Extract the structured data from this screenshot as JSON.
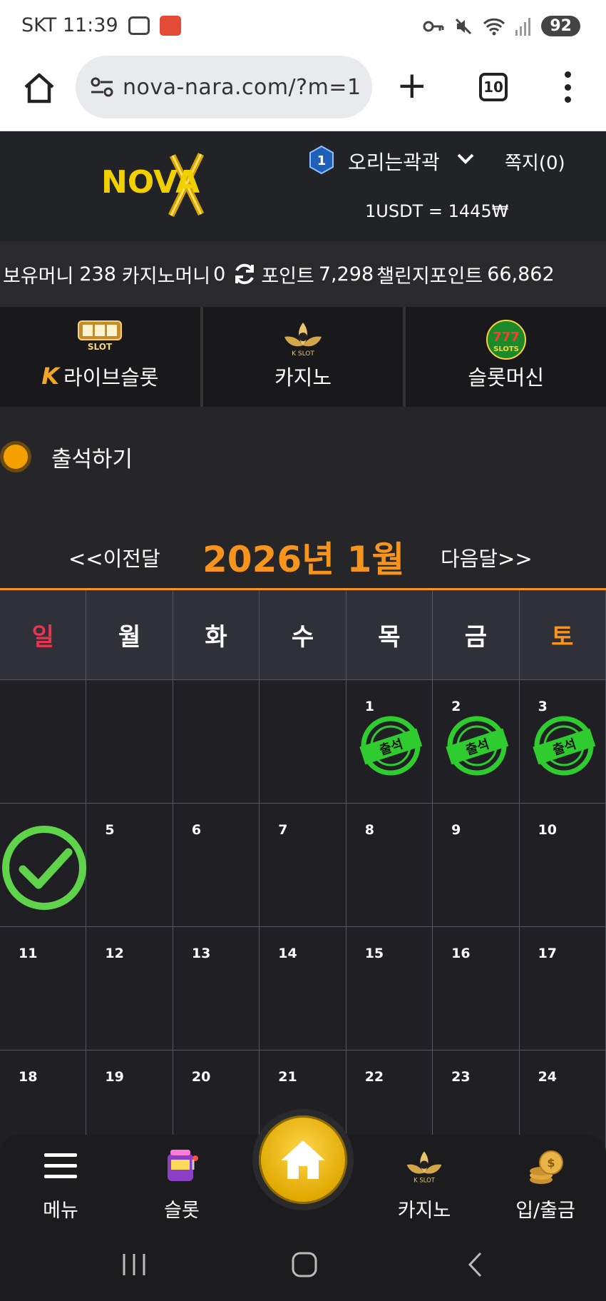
{
  "status_bar": {
    "carrier_time": "SKT 11:39",
    "battery": "92"
  },
  "browser": {
    "url": "nova-nara.com/?m=1",
    "tab_count": "10"
  },
  "header": {
    "logo_text": "NOVA",
    "level": "1",
    "username": "오리는곽곽",
    "memo": "쪽지(0)",
    "rate": "1USDT = 1445₩"
  },
  "money": {
    "hold_label": "보유머니",
    "hold_value": "238",
    "casino_label": "카지노머니",
    "casino_value": "0",
    "point_label": "포인트",
    "point_value": "7,298",
    "challenge_label": "챌린지포인트",
    "challenge_value": "66,862"
  },
  "categories": [
    {
      "label": "라이브슬롯",
      "icon": "live-slot-icon",
      "icon_text": "LIVE SLOT"
    },
    {
      "label": "카지노",
      "icon": "k-slot-lotus-icon",
      "icon_text": "K SLOT"
    },
    {
      "label": "슬롯머신",
      "icon": "777-slots-icon",
      "icon_text": "777 SLOTS"
    }
  ],
  "attendance": {
    "title": "출석하기",
    "stamp_text": "출석"
  },
  "calendar": {
    "prev": "<<이전달",
    "title": "2026년 1월",
    "next": "다음달>>",
    "weekdays": [
      "일",
      "월",
      "화",
      "수",
      "목",
      "금",
      "토"
    ],
    "days": [
      "",
      "",
      "",
      "",
      "1",
      "2",
      "3",
      "4",
      "5",
      "6",
      "7",
      "8",
      "9",
      "10",
      "11",
      "12",
      "13",
      "14",
      "15",
      "16",
      "17",
      "18",
      "19",
      "20",
      "21",
      "22",
      "23",
      "24"
    ],
    "stamped_days": [
      "1",
      "2",
      "3"
    ],
    "today": "4"
  },
  "bottom_nav": {
    "menu": "메뉴",
    "slot": "슬롯",
    "casino": "카지노",
    "deposit": "입/출금"
  },
  "colors": {
    "accent": "#f7941d",
    "stamp_green": "#2ecc2e",
    "check_green": "#5fd44a"
  }
}
